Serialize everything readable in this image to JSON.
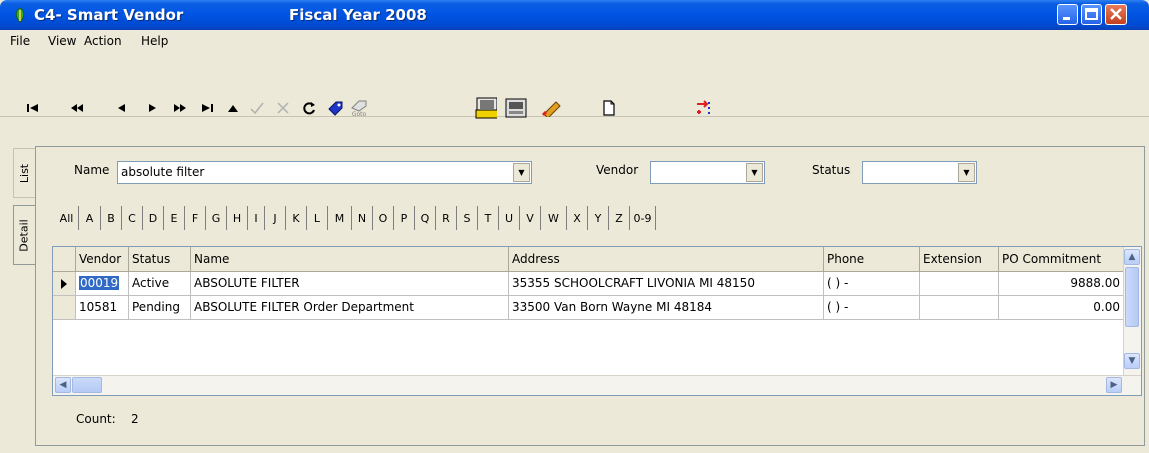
{
  "window": {
    "app_title": "C4- Smart Vendor",
    "fiscal_year": "Fiscal Year 2008"
  },
  "menu": [
    "File",
    "View",
    "Action",
    "Help"
  ],
  "toolbar": {
    "buttons": [
      "first-record",
      "prev-page",
      "prev-record",
      "next-record",
      "next-page",
      "last-record",
      "up",
      "accept",
      "cancel",
      "refresh",
      "tag",
      "goto",
      "filter",
      "report",
      "edit",
      "new-document",
      "transfer"
    ],
    "goto_label": "Goto",
    "filter_label": "Filter"
  },
  "side_tabs": {
    "list": "List",
    "detail": "Detail"
  },
  "filters": {
    "name_label": "Name",
    "name_value": "absolute filter",
    "vendor_label": "Vendor",
    "vendor_value": "",
    "status_label": "Status",
    "status_value": ""
  },
  "alphabet": [
    "All",
    "A",
    "B",
    "C",
    "D",
    "E",
    "F",
    "G",
    "H",
    "I",
    "J",
    "K",
    "L",
    "M",
    "N",
    "O",
    "P",
    "Q",
    "R",
    "S",
    "T",
    "U",
    "V",
    "W",
    "X",
    "Y",
    "Z",
    "0-9"
  ],
  "grid": {
    "columns": [
      "Vendor",
      "Status",
      "Name",
      "Address",
      "Phone",
      "Extension",
      "PO Commitment"
    ],
    "rows": [
      [
        "00019",
        "Active",
        "ABSOLUTE FILTER",
        "35355 SCHOOLCRAFT  LIVONIA MI 48150",
        "(  )  -",
        "",
        "9888.00"
      ],
      [
        "10581",
        "Pending",
        "ABSOLUTE FILTER Order Department",
        "33500 Van Born  Wayne MI 48184",
        "(  )  -",
        "",
        "0.00"
      ]
    ]
  },
  "footer": {
    "count_label": "Count:",
    "count_value": "2"
  }
}
